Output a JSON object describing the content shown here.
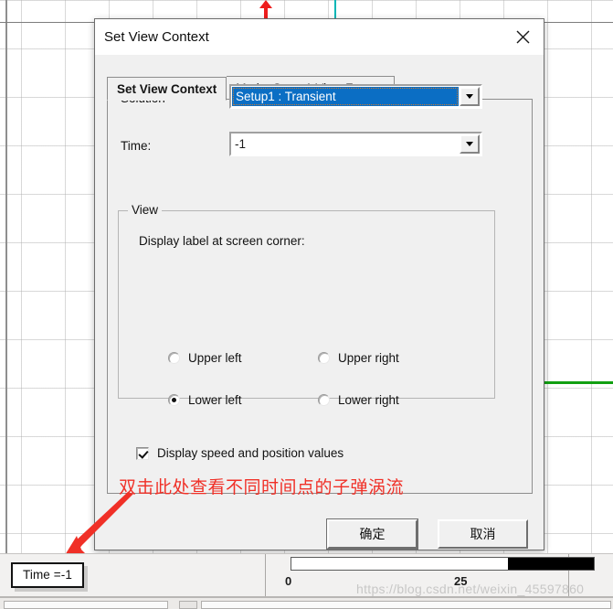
{
  "canvas": {
    "markers": {
      "red_top_arrow": "red-up-arrow-marker",
      "teal_line": "teal-vertical-line",
      "green_line": "green-horizontal-line"
    }
  },
  "dialog": {
    "title": "Set View Context",
    "close_icon": "close-icon",
    "tabs": [
      {
        "label": "Set View Context",
        "active": true
      },
      {
        "label": "MotionSetup1 View Format",
        "active": false
      }
    ],
    "fields": {
      "solution_label": "Solution",
      "solution_value": "Setup1 : Transient",
      "time_label": "Time:",
      "time_value": "-1",
      "dropdown_icon": "chevron-down-icon"
    },
    "view_group": {
      "title": "View",
      "display_label_prompt": "Display label at screen corner:",
      "radios": [
        {
          "label": "Upper left",
          "checked": false
        },
        {
          "label": "Upper right",
          "checked": false
        },
        {
          "label": "Lower left",
          "checked": true
        },
        {
          "label": "Lower right",
          "checked": false
        }
      ],
      "checkbox": {
        "label": "Display speed and position values",
        "checked": true
      }
    },
    "buttons": {
      "ok": "确定",
      "cancel": "取消"
    }
  },
  "annotation": {
    "text": "双击此处查看不同时间点的子弹涡流",
    "color": "#f03027",
    "arrow_icon": "red-arrow-pointing-down-left"
  },
  "bottom_bar": {
    "time_readout": "Time =-1",
    "slider": {
      "min_label": "0",
      "max_label": "25",
      "fill_percent": 72
    },
    "watermark": "https://blog.csdn.net/weixin_45597860"
  }
}
